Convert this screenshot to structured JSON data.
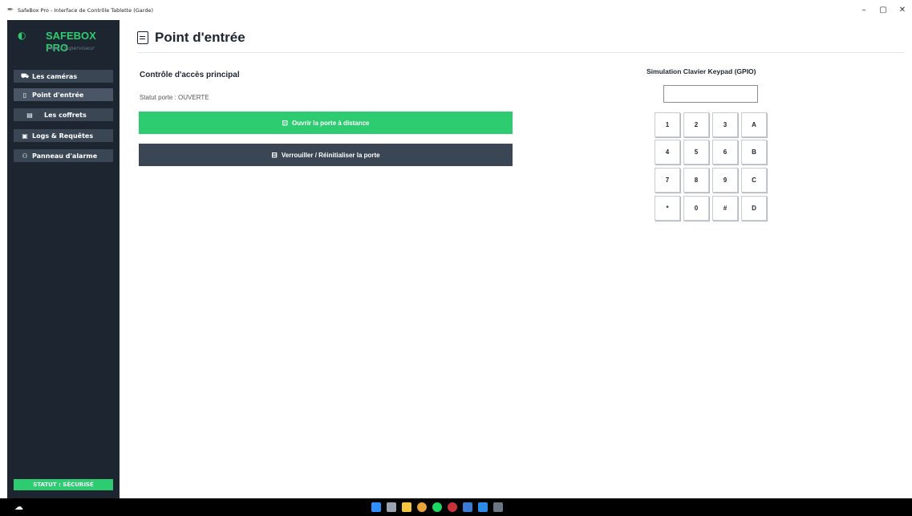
{
  "window": {
    "title": "SafeBox Pro - Interface de Contrôle Tablette (Garde)",
    "controls": [
      "–",
      "▢",
      "✕"
    ]
  },
  "sidebar": {
    "brand": "SAFEBOX PRO",
    "subtitle": "Menu Superviseur",
    "items": [
      {
        "label": "Les caméras",
        "icon": "camera-icon"
      },
      {
        "label": "Point d'entrée",
        "icon": "door-icon"
      },
      {
        "label": "Les coffrets",
        "icon": "safe-icon"
      },
      {
        "label": "Logs & Requêtes",
        "icon": "log-icon"
      },
      {
        "label": "Panneau d'alarme",
        "icon": "alarm-icon"
      }
    ],
    "status": "STATUT : SÉCURISÉ"
  },
  "main": {
    "page_title": "Point d'entrée",
    "section_title": "Contrôle d'accès principal",
    "door_status": "Statut porte : OUVERTE",
    "open_button": "Ouvrir la porte à distance",
    "lock_button": "Verrouiller / Réinitialiser la porte"
  },
  "keypad": {
    "title": "Simulation Clavier Keypad (GPIO)",
    "display_value": "",
    "keys": [
      "1",
      "2",
      "3",
      "A",
      "4",
      "5",
      "6",
      "B",
      "7",
      "8",
      "9",
      "C",
      "*",
      "0",
      "#",
      "D"
    ]
  },
  "colors": {
    "accent_green": "#2ecc71",
    "sidebar_bg": "#1d2630",
    "button_dark": "#3a4654"
  }
}
